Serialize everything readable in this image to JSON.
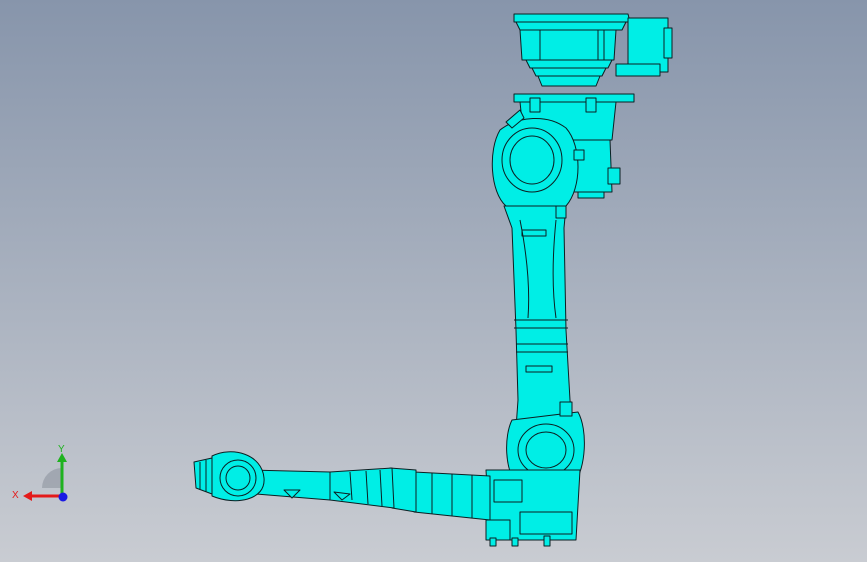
{
  "viewport": {
    "background_top": "#8795ab",
    "background_bottom": "#c9ccd2"
  },
  "model": {
    "part_color": "#00eee6",
    "part_color_dark": "#00c9c2",
    "edge_color": "#0b1f22"
  },
  "triad": {
    "x_label": "X",
    "y_label": "Y",
    "x_color": "#e41a1a",
    "y_color": "#1fb21f",
    "z_color": "#1a1ae4"
  }
}
